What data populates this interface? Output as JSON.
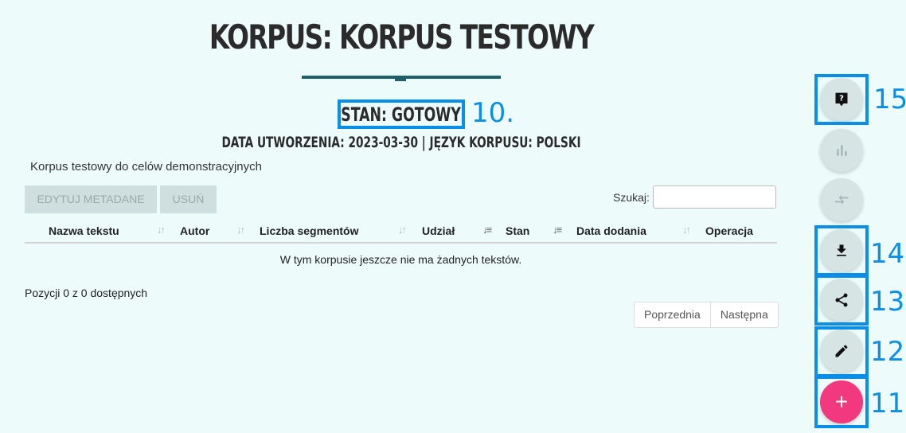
{
  "header": {
    "title": "KORPUS: KORPUS TESTOWY",
    "status": "STAN: GOTOWY",
    "meta": "DATA UTWORZENIA: 2023-03-30 | JĘZYK KORPUSU: POLSKI",
    "description": "Korpus testowy do celów demonstracyjnych"
  },
  "toolbar": {
    "edit_label": "EDYTUJ METADANE",
    "delete_label": "USUŃ",
    "search_label": "Szukaj:",
    "search_value": ""
  },
  "table": {
    "columns": [
      "Nazwa tekstu",
      "Autor",
      "Liczba segmentów",
      "Udział",
      "Stan",
      "Data dodania",
      "Operacja"
    ],
    "empty_message": "W tym korpusie jeszcze nie ma żadnych tekstów.",
    "info": "Pozycji 0 z 0 dostępnych"
  },
  "pagination": {
    "prev": "Poprzednia",
    "next": "Następna"
  },
  "fab": {
    "help_icon": "help-icon",
    "stats_icon": "bar-chart-icon",
    "compare_icon": "compare-arrows-icon",
    "download_icon": "download-icon",
    "share_icon": "share-icon",
    "edit_icon": "pencil-icon",
    "add_label": "+",
    "add_color": "#f2387e"
  },
  "annotations": {
    "a10": "10.",
    "a11": "11",
    "a12": "12",
    "a13": "13",
    "a14": "14",
    "a15": "15"
  },
  "colors": {
    "background": "#eefbfb",
    "accent_line": "#1f5f67",
    "highlight": "#0a8fe8"
  }
}
